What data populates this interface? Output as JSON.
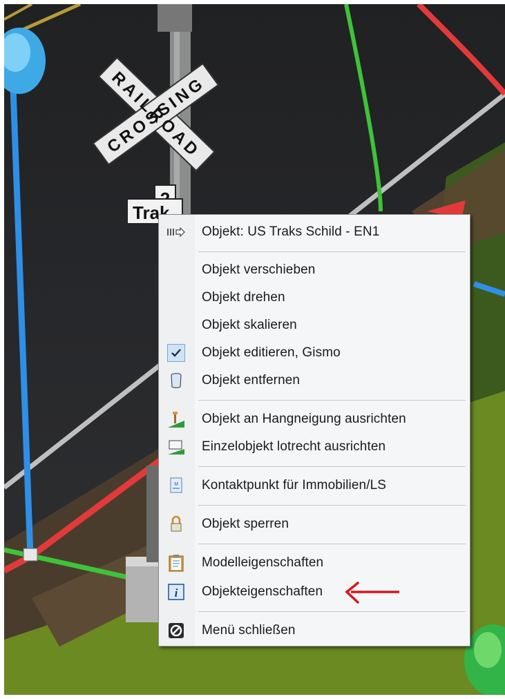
{
  "scene": {
    "sign_crossbuck_line1": "RAILROAD",
    "sign_crossbuck_line2": "CROSSING",
    "sign_number": "2",
    "sign_tracks_text": "Trak"
  },
  "menu": {
    "header": {
      "label": "Objekt: US  Traks  Schild - EN1",
      "icon": "object-arrow-icon"
    },
    "items": [
      {
        "label": "Objekt verschieben",
        "icon": ""
      },
      {
        "label": "Objekt drehen",
        "icon": ""
      },
      {
        "label": "Objekt skalieren",
        "icon": ""
      },
      {
        "label": "Objekt editieren, Gismo",
        "icon": "checkmark-icon",
        "checked": true
      },
      {
        "label": "Objekt entfernen",
        "icon": "trash-bin-icon"
      },
      {
        "label": "Objekt an Hangneigung ausrichten",
        "icon": "slope-align-icon"
      },
      {
        "label": "Einzelobjekt lotrecht ausrichten",
        "icon": "vertical-align-icon"
      },
      {
        "label": "Kontaktpunkt für Immobilien/LS",
        "icon": "contact-point-icon"
      },
      {
        "label": "Objekt sperren",
        "icon": "padlock-icon"
      },
      {
        "label": "Modelleigenschaften",
        "icon": "clipboard-icon"
      },
      {
        "label": "Objekteigenschaften",
        "icon": "info-icon"
      },
      {
        "label": "Menü schließen",
        "icon": "close-circle-icon"
      }
    ]
  },
  "colors": {
    "annotation_arrow": "#d8151b",
    "axis_x": "#e23a3a",
    "axis_y": "#3fc23a",
    "axis_z": "#2f8fe6",
    "check_highlight": "#cfe3f5"
  }
}
